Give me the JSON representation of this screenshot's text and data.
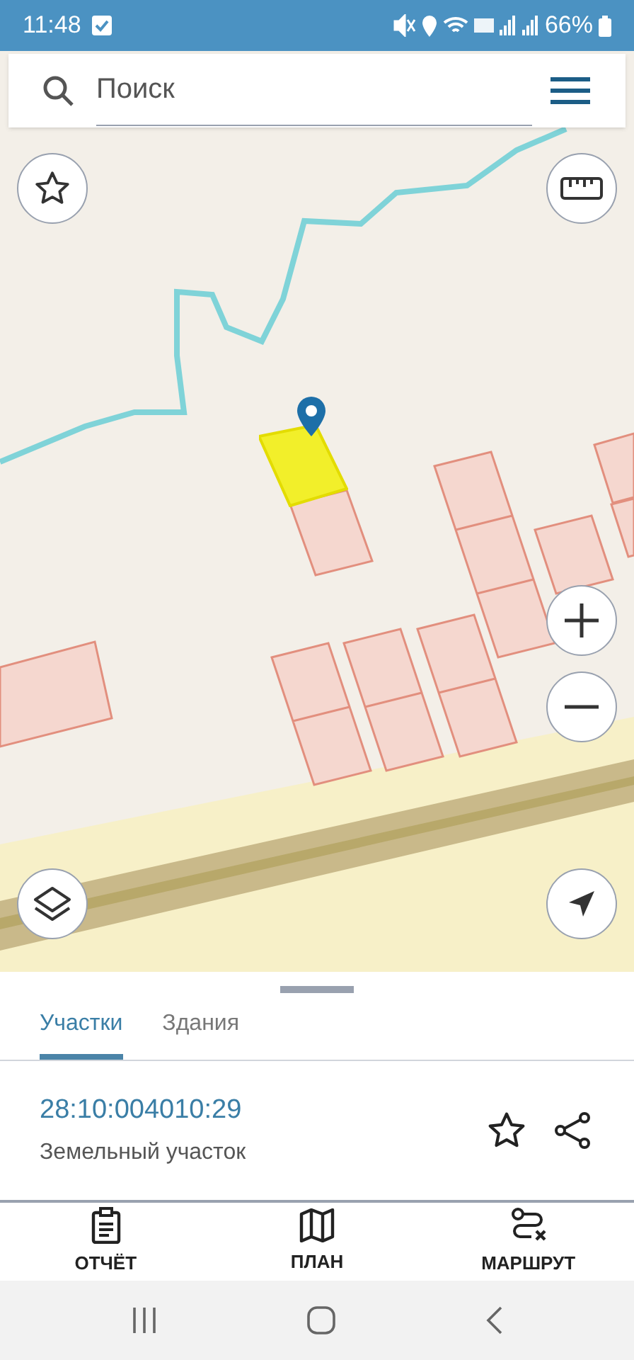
{
  "status_bar": {
    "time": "11:48",
    "battery": "66%"
  },
  "search": {
    "placeholder": "Поиск"
  },
  "tabs": [
    {
      "label": "Участки",
      "selected": true
    },
    {
      "label": "Здания",
      "selected": false
    }
  ],
  "result": {
    "number": "28:10:004010:29",
    "type": "Земельный участок"
  },
  "bottom_nav": [
    {
      "label": "ОТЧЁТ",
      "kind": "report"
    },
    {
      "label": "ПЛАН",
      "kind": "map"
    },
    {
      "label": "МАРШРУТ",
      "kind": "route"
    }
  ]
}
